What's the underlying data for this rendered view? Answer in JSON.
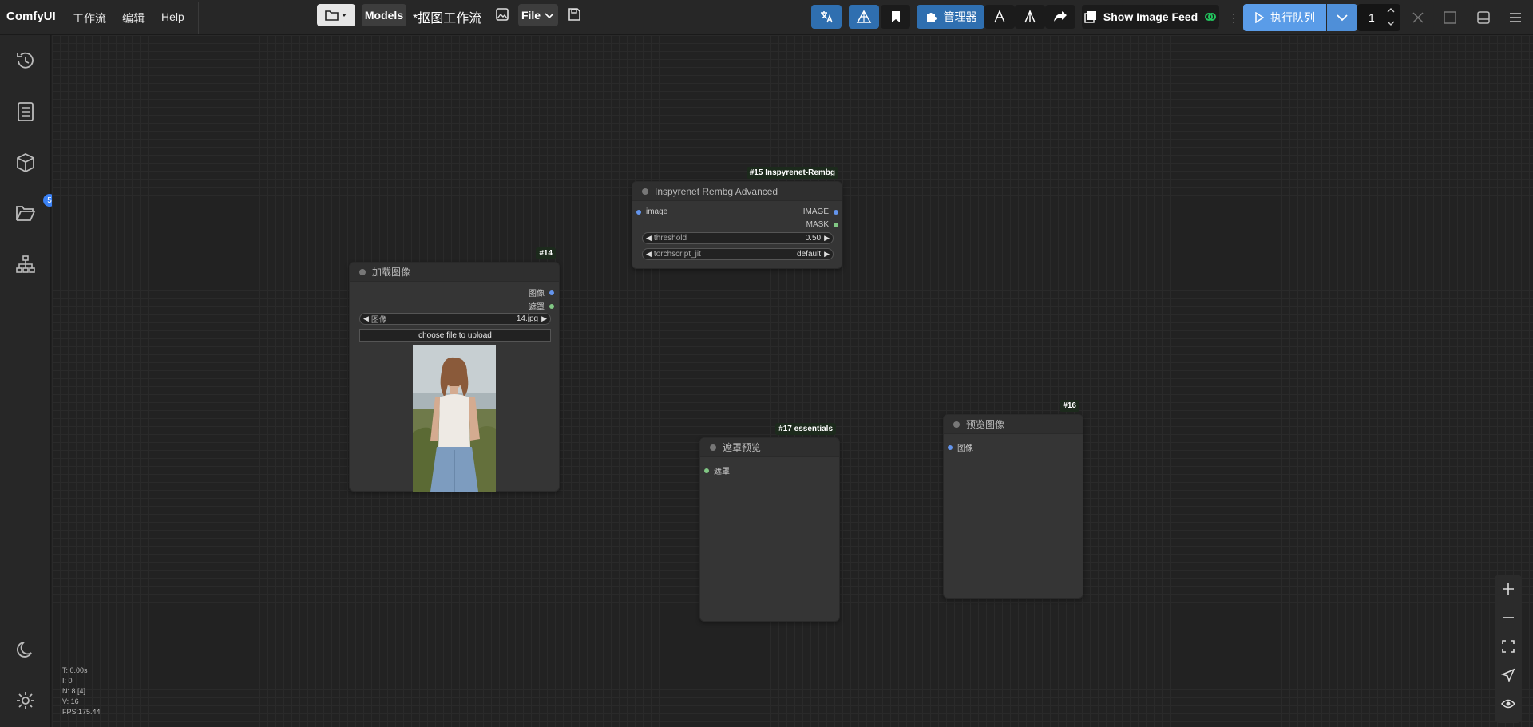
{
  "app": {
    "brand": "ComfyUI"
  },
  "menu": {
    "workflow": "工作流",
    "edit": "编辑",
    "help": "Help"
  },
  "toolbar": {
    "models_label": "Models",
    "workflow_title": "*抠图工作流",
    "file_label": "File",
    "manager_label": "管理器",
    "image_feed_label": "Show Image Feed",
    "run_label": "执行队列",
    "batch_count": "1"
  },
  "sidebar": {
    "queue_badge": "5"
  },
  "nodes": {
    "load_image": {
      "id_badge": "#14",
      "title": "加载图像",
      "output_image": "图像",
      "output_mask": "遮罩",
      "widget_image_label": "图像",
      "widget_image_value": "14.jpg",
      "upload_label": "choose file to upload"
    },
    "rembg": {
      "id_badge": "#15 Inspyrenet-Rembg",
      "title": "Inspyrenet Rembg Advanced",
      "input_image": "image",
      "output_image": "IMAGE",
      "output_mask": "MASK",
      "threshold_label": "threshold",
      "threshold_value": "0.50",
      "torchscript_label": "torchscript_jit",
      "torchscript_value": "default"
    },
    "mask_preview": {
      "id_badge": "#17 essentials",
      "title": "遮罩预览",
      "input_mask": "遮罩"
    },
    "preview_image": {
      "id_badge": "#16",
      "title": "预览图像",
      "input_image": "图像"
    }
  },
  "stats": {
    "t": "T: 0.00s",
    "i": "I: 0",
    "n": "N: 8 [4]",
    "v": "V: 16",
    "fps": "FPS:175.44"
  },
  "colors": {
    "slot_image": "#6495ed",
    "slot_mask": "#81c784",
    "accent": "#5a9ce8"
  }
}
